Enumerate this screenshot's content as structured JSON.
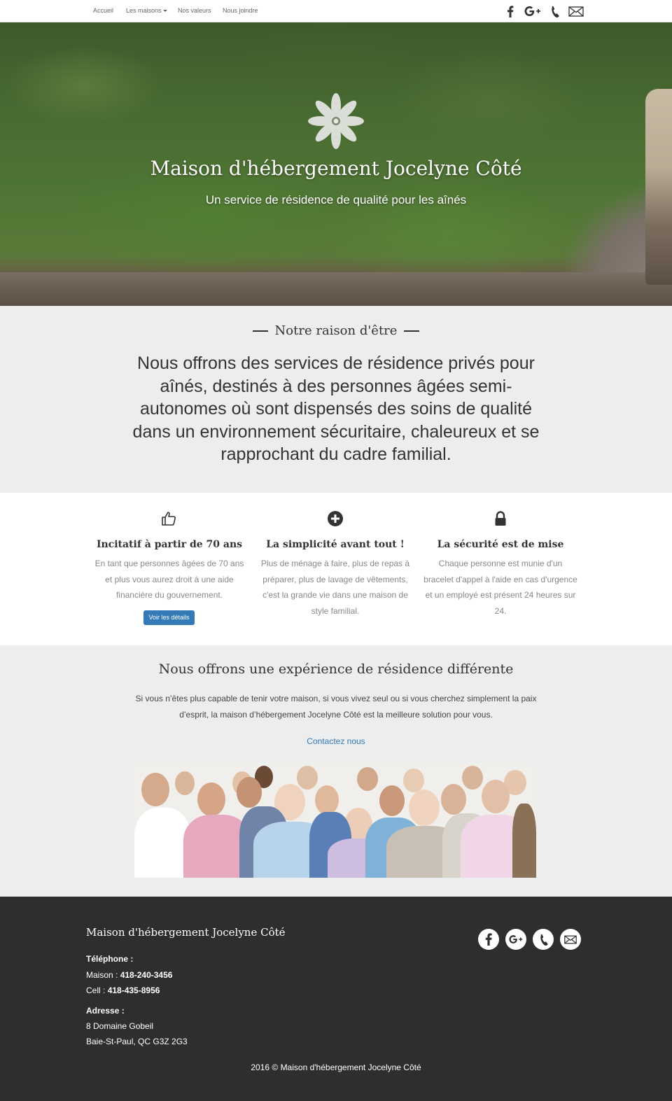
{
  "nav": {
    "links": [
      "Accueil",
      "Les maisons",
      "Nos valeurs",
      "Nous joindre"
    ],
    "social_icons": [
      "facebook-icon",
      "google-plus-icon",
      "phone-icon",
      "mail-icon"
    ]
  },
  "hero": {
    "title": "Maison d'hébergement Jocelyne Côté",
    "subtitle": "Un service de résidence de qualité pour les aînés"
  },
  "raison": {
    "heading": "Notre raison d'être",
    "text": "Nous offrons des services de résidence privés pour aînés, destinés à des personnes âgées semi-autonomes où sont dispensés des soins de qualité dans un environnement sécuritaire, chaleureux et se rapprochant du cadre familial."
  },
  "features": [
    {
      "icon": "thumbs-up-icon",
      "title": "Incitatif à partir de 70 ans",
      "text": "En tant que personnes âgées de 70 ans et plus vous aurez droit à une aide financière du gouvernement.",
      "button": "Voir les détails"
    },
    {
      "icon": "plus-circle-icon",
      "title": "La simplicité avant tout !",
      "text": "Plus de ménage à faire, plus de repas à préparer, plus de lavage de vêtements, c'est la grande vie dans une maison de style familial."
    },
    {
      "icon": "lock-icon",
      "title": "La sécurité est de mise",
      "text": "Chaque personne est munie d'un bracelet d'appel à l'aide en cas d'urgence et un employé est présent 24 heures sur 24."
    }
  ],
  "experience": {
    "title": "Nous offrons une expérience de résidence différente",
    "text": "Si vous n’êtes plus capable de tenir votre maison, si vous vivez seul ou si vous cherchez simplement la paix d’esprit, la maison d’hébergement Jocelyne Côté est la meilleure solution pour vous.",
    "link": "Contactez nous"
  },
  "footer": {
    "title": "Maison d'hébergement Jocelyne Côté",
    "phone_label": "Téléphone :",
    "maison_label": "Maison :",
    "maison_number": "418-240-3456",
    "cell_label": "Cell :",
    "cell_number": "418-435-8956",
    "address_label": "Adresse :",
    "address_line1": "8 Domaine Gobeil",
    "address_line2": "Baie-St-Paul, QC G3Z 2G3",
    "copyright": "2016 © Maison d'hébergement Jocelyne Côté"
  },
  "colors": {
    "accent": "#337ab7",
    "section_bg": "#ecedee",
    "footer_bg": "#2e2e2e"
  }
}
